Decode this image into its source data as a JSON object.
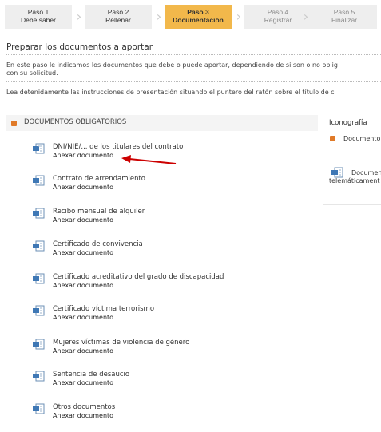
{
  "stepper": {
    "steps": [
      {
        "number": "Paso 1",
        "name": "Debe saber",
        "state": "done"
      },
      {
        "number": "Paso 2",
        "name": "Rellenar",
        "state": "done"
      },
      {
        "number": "Paso 3",
        "name": "Documentación",
        "state": "active"
      },
      {
        "number": "Paso 4",
        "name": "Registrar",
        "state": "pending"
      },
      {
        "number": "Paso 5",
        "name": "Finalizar",
        "state": "pending"
      }
    ],
    "separator_icon": "chevron-right-icon"
  },
  "main": {
    "title": "Preparar los documentos a aportar",
    "intro_line1": "En este paso le indicamos los documentos que debe o puede aportar, dependiendo de si son o no oblig",
    "intro_line2": "con su solicitud.",
    "instructions": "Lea detenidamente las instrucciones de presentación situando el puntero del ratón sobre el título de c"
  },
  "documents": {
    "header": "DOCUMENTOS OBLIGATORIOS",
    "header_icon": "required-square-icon",
    "items": [
      {
        "label": "DNI/NIE/... de los titulares del contrato",
        "link": "Anexar documento"
      },
      {
        "label": "Contrato de arrendamiento",
        "link": "Anexar documento"
      },
      {
        "label": "Recibo mensual de alquiler",
        "link": "Anexar documento"
      },
      {
        "label": "Certificado de convivencia",
        "link": "Anexar documento"
      },
      {
        "label": "Certificado acreditativo del grado de discapacidad",
        "link": "Anexar documento"
      },
      {
        "label": "Certificado víctima terrorismo",
        "link": "Anexar documento"
      },
      {
        "label": "Mujeres víctimas de violencia de género",
        "link": "Anexar documento"
      },
      {
        "label": "Sentencia de desaucio",
        "link": "Anexar documento"
      },
      {
        "label": "Otros documentos",
        "link": "Anexar documento"
      }
    ]
  },
  "iconography": {
    "title": "Iconografía",
    "required_label": "Documento",
    "telematic_label_1": "Documen",
    "telematic_label_2": "telemáticament"
  },
  "colors": {
    "active_step": "#f2b84b",
    "required_badge": "#e07a28",
    "arrow": "#cc0000"
  }
}
